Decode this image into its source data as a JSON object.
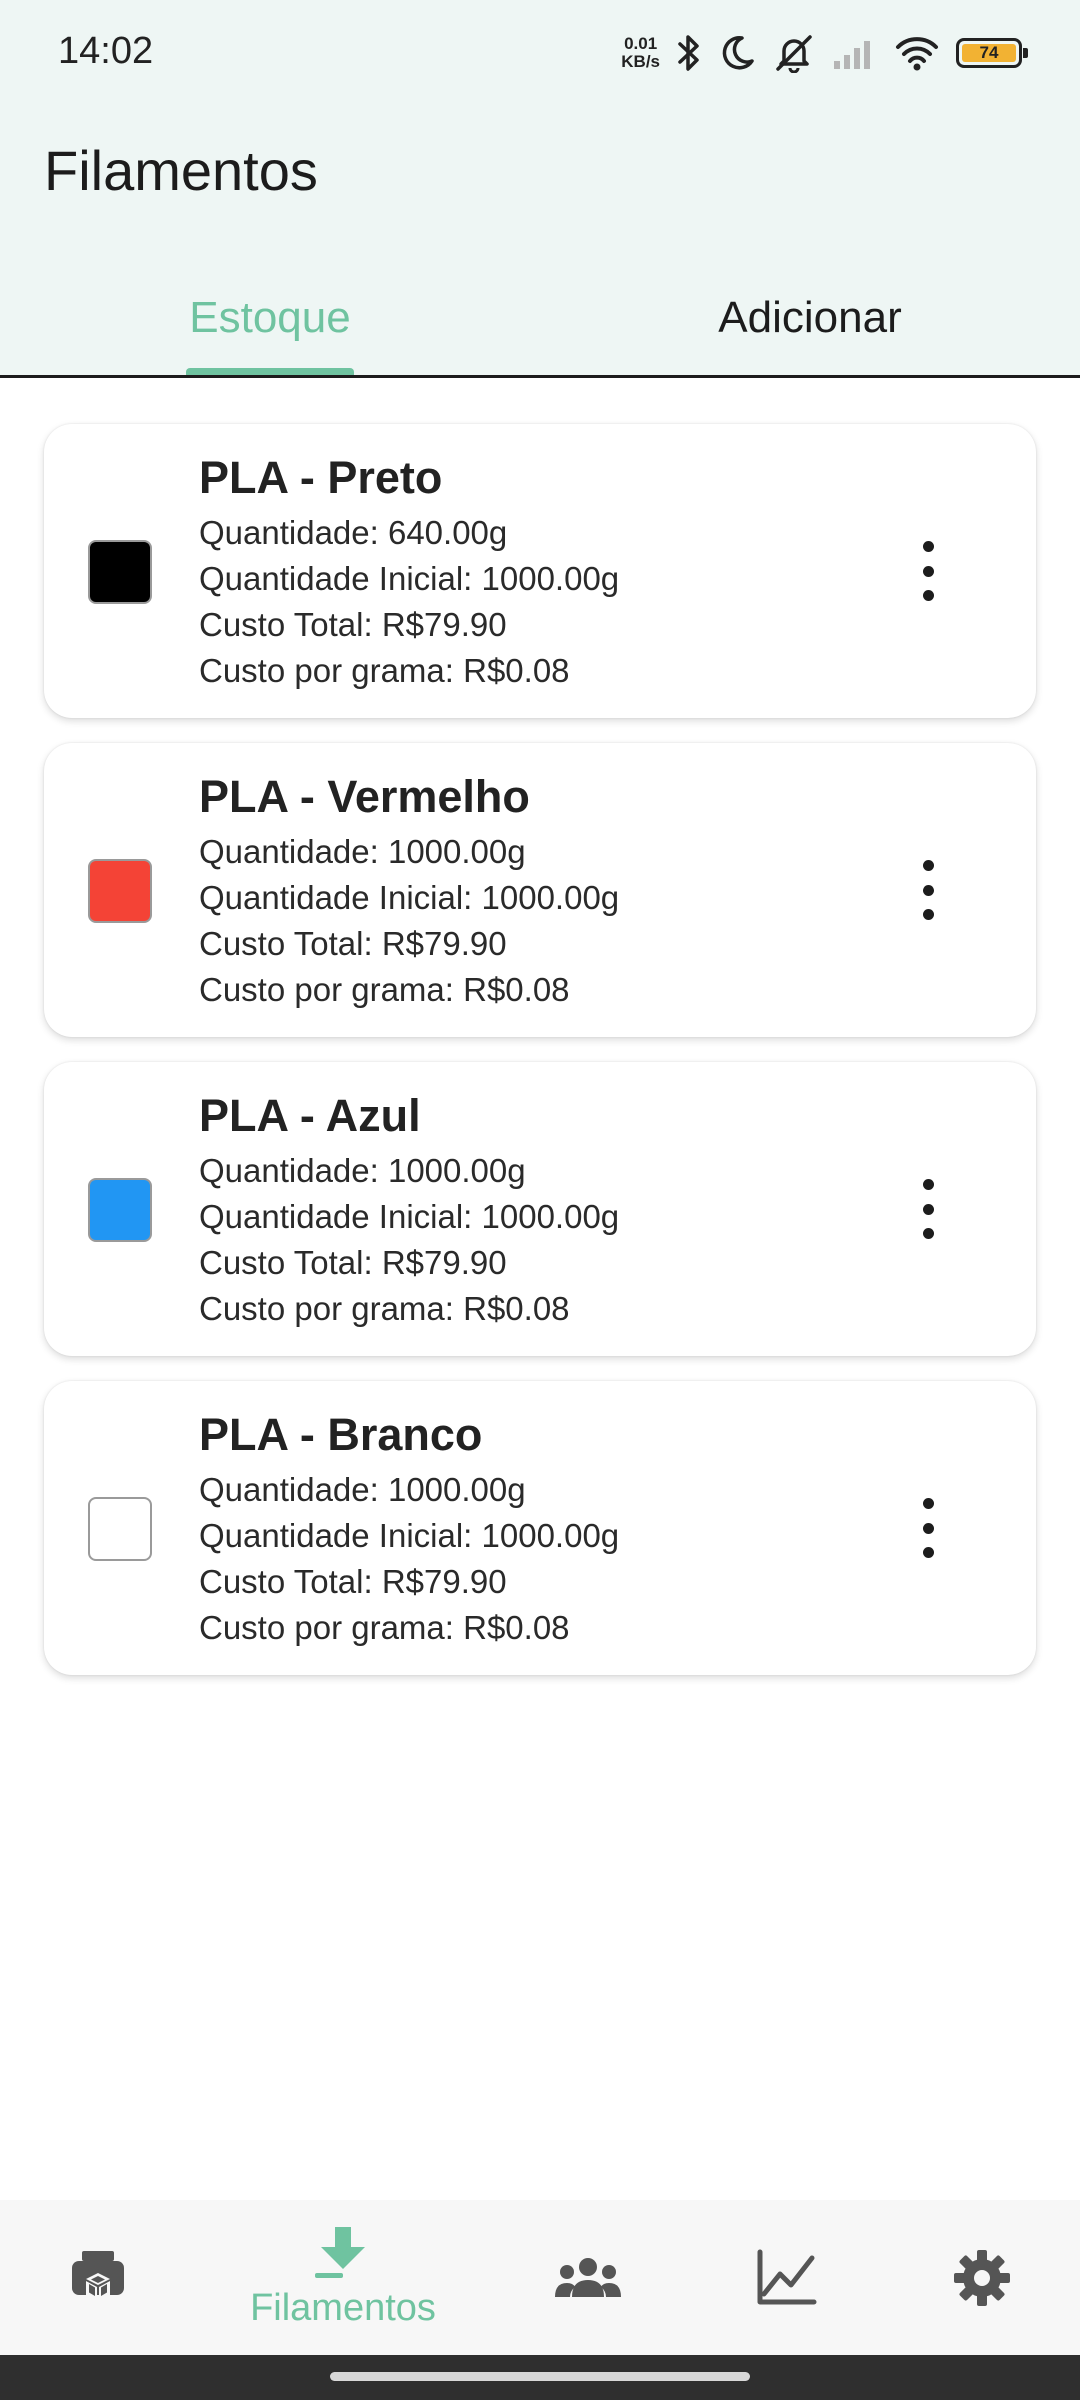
{
  "status_bar": {
    "time": "14:02",
    "net_speed_value": "0.01",
    "net_speed_unit": "KB/s",
    "battery": "74",
    "battery_color": "#f2b233"
  },
  "app_bar": {
    "title": "Filamentos"
  },
  "tabs": [
    {
      "label": "Estoque",
      "active": true
    },
    {
      "label": "Adicionar",
      "active": false
    }
  ],
  "accent_color": "#6fc3a0",
  "filaments": [
    {
      "title": "PLA - Preto",
      "color": "#000000",
      "quantidade": "Quantidade: 640.00g",
      "quantidade_inicial": "Quantidade Inicial: 1000.00g",
      "custo_total": "Custo Total: R$79.90",
      "custo_grama": "Custo por grama: R$0.08"
    },
    {
      "title": "PLA - Vermelho",
      "color": "#f44336",
      "quantidade": "Quantidade: 1000.00g",
      "quantidade_inicial": "Quantidade Inicial: 1000.00g",
      "custo_total": "Custo Total: R$79.90",
      "custo_grama": "Custo por grama: R$0.08"
    },
    {
      "title": "PLA - Azul",
      "color": "#2196f3",
      "quantidade": "Quantidade: 1000.00g",
      "quantidade_inicial": "Quantidade Inicial: 1000.00g",
      "custo_total": "Custo Total: R$79.90",
      "custo_grama": "Custo por grama: R$0.08"
    },
    {
      "title": "PLA - Branco",
      "color": "#ffffff",
      "quantidade": "Quantidade: 1000.00g",
      "quantidade_inicial": "Quantidade Inicial: 1000.00g",
      "custo_total": "Custo Total: R$79.90",
      "custo_grama": "Custo por grama: R$0.08"
    }
  ],
  "bottom_nav": [
    {
      "icon": "printer-box-icon",
      "label": "",
      "active": false
    },
    {
      "icon": "filament-download-icon",
      "label": "Filamentos",
      "active": true
    },
    {
      "icon": "people-icon",
      "label": "",
      "active": false
    },
    {
      "icon": "line-chart-icon",
      "label": "",
      "active": false
    },
    {
      "icon": "gear-icon",
      "label": "",
      "active": false
    }
  ]
}
